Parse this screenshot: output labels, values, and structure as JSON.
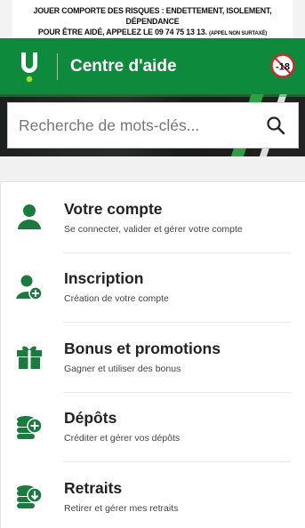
{
  "warning": {
    "line1": "JOUER COMPORTE DES RISQUES : ENDETTEMENT, ISOLEMENT, DÉPENDANCE",
    "line2": "POUR ÊTRE AIDÉ, APPELEZ LE 09 74 75 13 13.",
    "line2_small": "(APPEL NON SURTAXÉ)"
  },
  "header": {
    "title": "Centre d'aide",
    "logo_icon": "unibet-u-logo",
    "age_badge": "-18"
  },
  "search": {
    "placeholder": "Recherche de mots-clés..."
  },
  "categories": [
    {
      "title": "Votre compte",
      "subtitle": "Se connecter, valider et gérer votre compte",
      "icon": "user-icon"
    },
    {
      "title": "Inscription",
      "subtitle": "Création de votre compte",
      "icon": "user-add-icon"
    },
    {
      "title": "Bonus et promotions",
      "subtitle": "Gagner et utiliser des bonus",
      "icon": "gift-icon"
    },
    {
      "title": "Dépôts",
      "subtitle": "Créditer et gérer vos dépôts",
      "icon": "coins-plus-icon"
    },
    {
      "title": "Retraits",
      "subtitle": "Retirer et gérer mes retraits",
      "icon": "coins-down-icon"
    }
  ],
  "colors": {
    "brand_green": "#0e8a3c",
    "icon_green": "#1b7a3e"
  }
}
